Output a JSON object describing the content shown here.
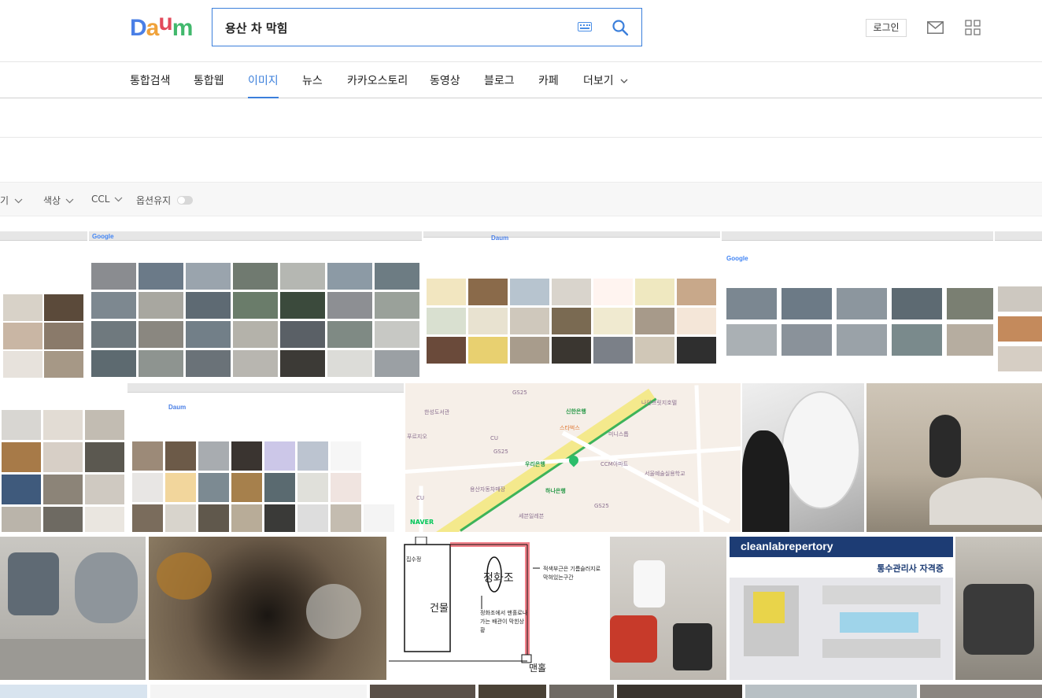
{
  "logo": {
    "letters": [
      "D",
      "a",
      "u",
      "m"
    ],
    "colors": [
      "#4a7fe6",
      "#f0a23a",
      "#e24a5b",
      "#41b86c"
    ]
  },
  "search": {
    "query": "용산 차 막힘",
    "keyboard_icon": "keyboard-icon",
    "button_icon": "search-icon"
  },
  "header": {
    "login_label": "로그인",
    "mail_icon": "mail-icon",
    "apps_icon": "apps-grid-icon"
  },
  "tabs": [
    {
      "label": "통합검색"
    },
    {
      "label": "통합웹"
    },
    {
      "label": "이미지",
      "active": true
    },
    {
      "label": "뉴스"
    },
    {
      "label": "카카오스토리"
    },
    {
      "label": "동영상"
    },
    {
      "label": "블로그"
    },
    {
      "label": "카페"
    },
    {
      "label": "더보기"
    }
  ],
  "filters": {
    "size_label": "기",
    "color_label": "색상",
    "ccl_label": "CCL",
    "keep_option_label": "옵션유지"
  },
  "accent_color": "#3b7fdb",
  "results": {
    "google_logo": "Google",
    "daum_logo": "Daum",
    "search_text": "용산 차 막힘",
    "map_labels": {
      "gs25": "GS25",
      "cu": "CU",
      "shinhan": "신한은행",
      "woori": "우리은행",
      "hana": "하나은행",
      "library": "한성도서관",
      "prugio": "푸르지오",
      "cafe": "스타벅스",
      "mart": "미니스톱",
      "naver": "NAVER",
      "hotel": "나인브릿지호텔",
      "school": "서울예술실용학교",
      "market": "용산자동차매장",
      "cct": "CCM아파트",
      "apt": "세븐일레븐"
    },
    "diagram": {
      "septic": "정화조",
      "building": "건물",
      "manhole": "맨홀",
      "catch": "집수정",
      "note1": "적색부근은 기름슬러지로",
      "note2": "막혀있는구간",
      "note3": "정화조에서 맨홀로나",
      "note4": "가는 배관이 막힌상",
      "note5": "황"
    },
    "cert": {
      "brand": "cleanlabrepertory",
      "title": "통수관리사 자격증"
    }
  }
}
